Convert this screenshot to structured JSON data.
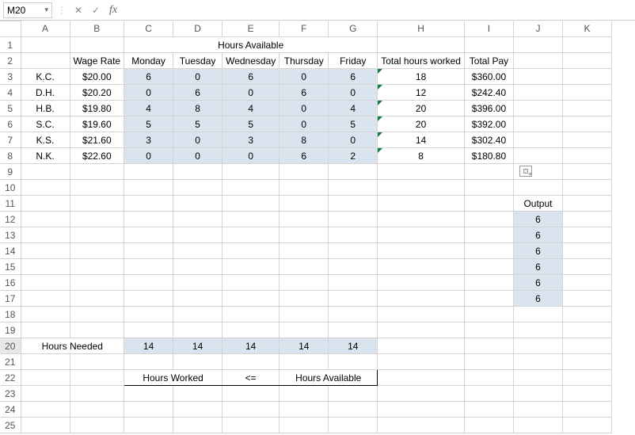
{
  "formula_bar": {
    "cell_ref": "M20",
    "formula": ""
  },
  "columns": [
    "A",
    "B",
    "C",
    "D",
    "E",
    "F",
    "G",
    "H",
    "I",
    "J",
    "K"
  ],
  "rows": [
    1,
    2,
    3,
    4,
    5,
    6,
    7,
    8,
    9,
    10,
    11,
    12,
    13,
    14,
    15,
    16,
    17,
    18,
    19,
    20,
    21,
    22,
    23,
    24,
    25
  ],
  "title": "Hours Available",
  "headers": {
    "wage_rate": "Wage Rate",
    "days": [
      "Monday",
      "Tuesday",
      "Wednesday",
      "Thursday",
      "Friday"
    ],
    "total_hours": "Total hours worked",
    "total_pay": "Total Pay"
  },
  "employees": [
    {
      "name": "K.C.",
      "wage": "$20.00",
      "hours": [
        "6",
        "0",
        "6",
        "0",
        "6"
      ],
      "total": "18",
      "pay": "$360.00"
    },
    {
      "name": "D.H.",
      "wage": "$20.20",
      "hours": [
        "0",
        "6",
        "0",
        "6",
        "0"
      ],
      "total": "12",
      "pay": "$242.40"
    },
    {
      "name": "H.B.",
      "wage": "$19.80",
      "hours": [
        "4",
        "8",
        "4",
        "0",
        "4"
      ],
      "total": "20",
      "pay": "$396.00"
    },
    {
      "name": "S.C.",
      "wage": "$19.60",
      "hours": [
        "5",
        "5",
        "5",
        "0",
        "5"
      ],
      "total": "20",
      "pay": "$392.00"
    },
    {
      "name": "K.S.",
      "wage": "$21.60",
      "hours": [
        "3",
        "0",
        "3",
        "8",
        "0"
      ],
      "total": "14",
      "pay": "$302.40"
    },
    {
      "name": "N.K.",
      "wage": "$22.60",
      "hours": [
        "0",
        "0",
        "0",
        "6",
        "2"
      ],
      "total": "8",
      "pay": "$180.80"
    }
  ],
  "output": {
    "label": "Output",
    "values": [
      "6",
      "6",
      "6",
      "6",
      "6",
      "6"
    ]
  },
  "hours_needed": {
    "label": "Hours Needed",
    "values": [
      "14",
      "14",
      "14",
      "14",
      "14"
    ]
  },
  "constraint": {
    "left": "Hours Worked",
    "op": "<=",
    "right": "Hours Available"
  }
}
